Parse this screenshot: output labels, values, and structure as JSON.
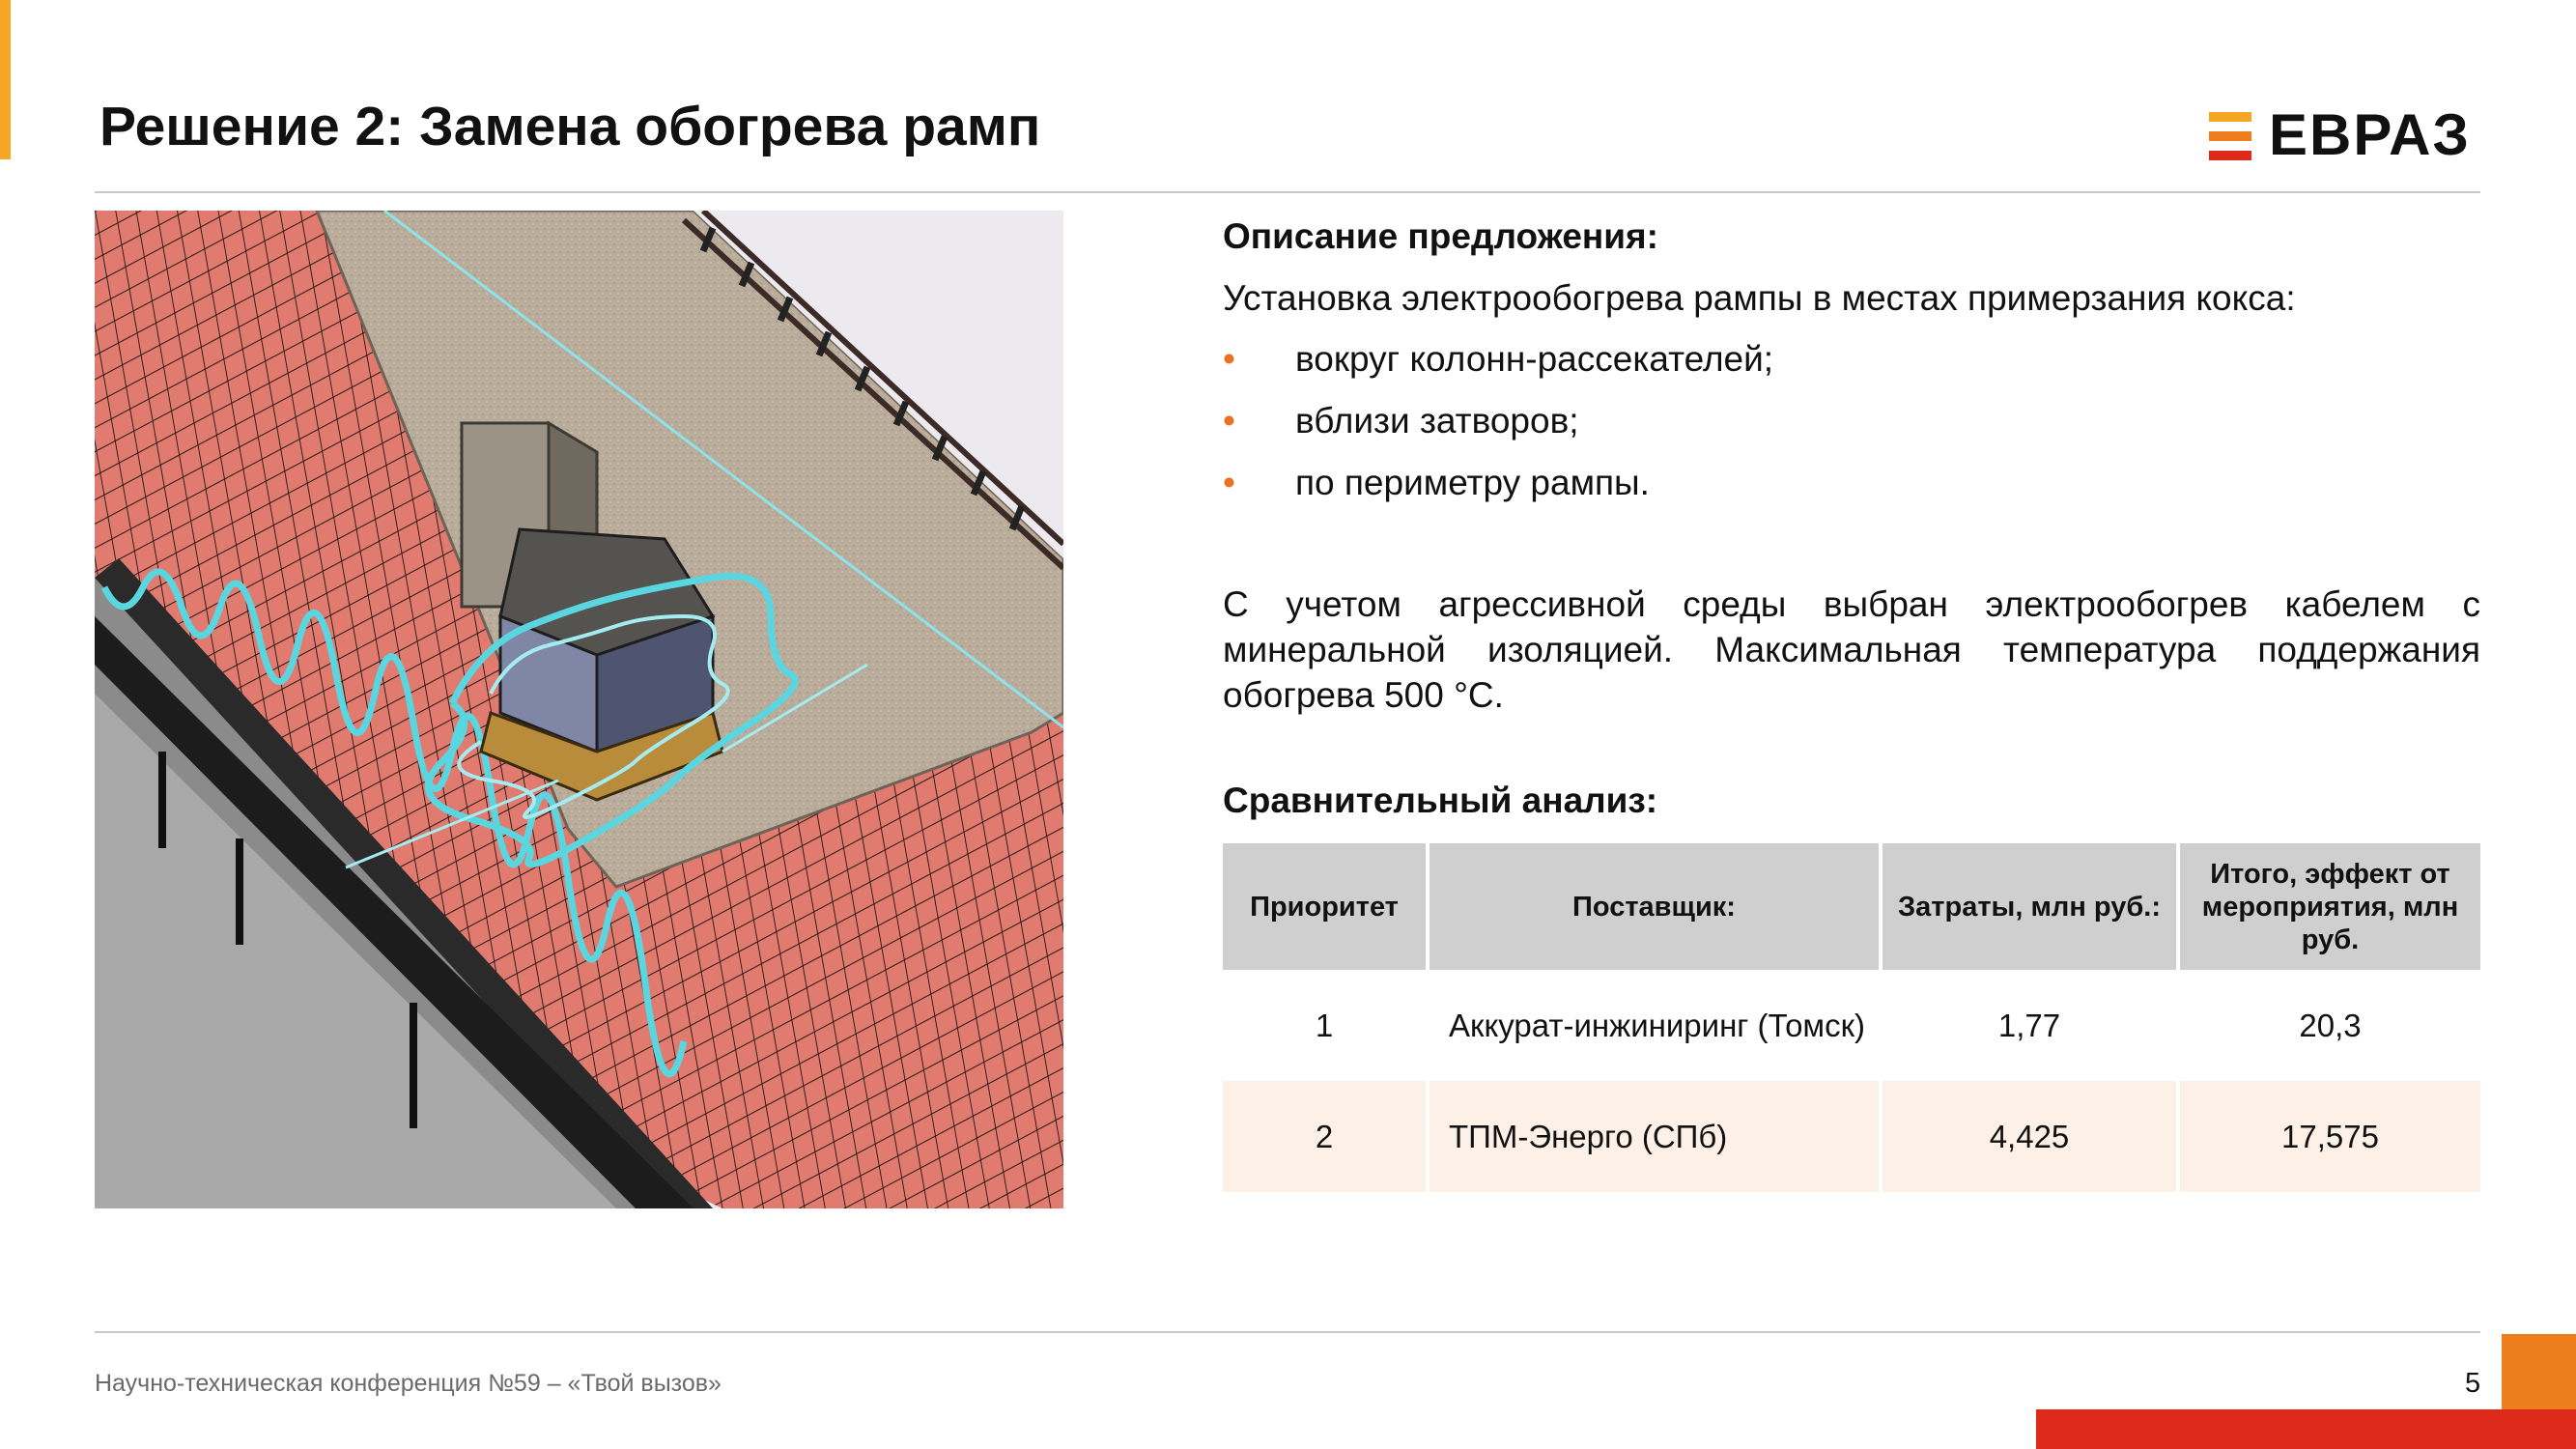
{
  "slide": {
    "title": "Решение 2: Замена обогрева рамп",
    "page_number": "5"
  },
  "logo": {
    "text": "ЕВРАЗ",
    "bar_colors": [
      "#f5a623",
      "#ee7d1d",
      "#dd2a1b"
    ]
  },
  "image": {
    "icon": "ramp-heating-cable-render"
  },
  "description": {
    "heading": "Описание предложения:",
    "intro": "Установка электрообогрева рампы в местах примерзания кокса:",
    "bullet_marker": "•",
    "bullets": [
      "вокруг колонн-рассекателей;",
      "вблизи затворов;",
      "по периметру рампы."
    ],
    "paragraph": "С учетом агрессивной среды выбран электрообогрев кабелем с минеральной изоляцией. Максимальная температура поддержания обогрева 500 °С."
  },
  "comparison": {
    "heading": "Сравнительный анализ:",
    "columns": [
      "Приоритет",
      "Поставщик:",
      "Затраты, млн руб.:",
      "Итого, эффект от мероприятия, млн руб."
    ],
    "rows": [
      [
        "1",
        "Аккурат-инжиниринг (Томск)",
        "1,77",
        "20,3"
      ],
      [
        "2",
        "ТПМ-Энерго (СПб)",
        "4,425",
        "17,575"
      ]
    ]
  },
  "footer": {
    "text": "Научно-техническая конференция №59 – «Твой вызов»"
  },
  "colors": {
    "accent_orange": "#ee7d1d",
    "accent_red": "#dd2a1b",
    "accent_yellow": "#f5a623",
    "table_header": "#cfcfcf",
    "table_alt_row": "#fdf1e7",
    "heating_cable": "#5ad6e0",
    "ramp_tiles": "#e27b6f"
  }
}
